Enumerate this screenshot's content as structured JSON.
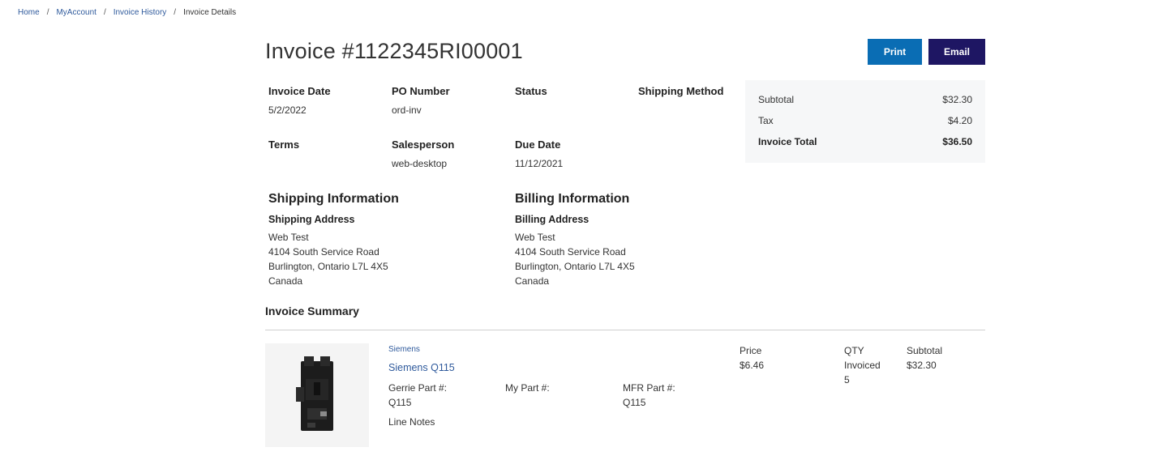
{
  "breadcrumb": {
    "items": [
      "Home",
      "MyAccount",
      "Invoice History"
    ],
    "current": "Invoice Details",
    "separator": "/"
  },
  "invoice": {
    "title": "Invoice #1122345RI00001"
  },
  "actions": {
    "print_label": "Print",
    "email_label": "Email"
  },
  "details": {
    "invoice_date_label": "Invoice Date",
    "invoice_date": "5/2/2022",
    "po_number_label": "PO Number",
    "po_number": "ord-inv",
    "status_label": "Status",
    "status": "",
    "shipping_method_label": "Shipping Method",
    "shipping_method": "",
    "terms_label": "Terms",
    "terms": "",
    "salesperson_label": "Salesperson",
    "salesperson": "web-desktop",
    "due_date_label": "Due Date",
    "due_date": "11/12/2021"
  },
  "totals": {
    "subtotal_label": "Subtotal",
    "subtotal": "$32.30",
    "tax_label": "Tax",
    "tax": "$4.20",
    "total_label": "Invoice Total",
    "total": "$36.50"
  },
  "shipping": {
    "heading": "Shipping Information",
    "address_label": "Shipping Address",
    "lines": [
      "Web Test",
      "4104 South Service Road",
      "Burlington, Ontario L7L 4X5",
      "Canada"
    ]
  },
  "billing": {
    "heading": "Billing Information",
    "address_label": "Billing Address",
    "lines": [
      "Web Test",
      "4104 South Service Road",
      "Burlington, Ontario L7L 4X5",
      "Canada"
    ]
  },
  "summary": {
    "heading": "Invoice Summary",
    "items": [
      {
        "brand": "Siemens",
        "name": "Siemens Q115",
        "gerrie_part_label": "Gerrie Part #:",
        "gerrie_part": "Q115",
        "my_part_label": "My Part #:",
        "my_part": "",
        "mfr_part_label": "MFR Part #:",
        "mfr_part": "Q115",
        "line_notes_label": "Line Notes",
        "price_label": "Price",
        "price": "$6.46",
        "qty_label": "QTY",
        "qty_sublabel": "Invoiced",
        "qty": "5",
        "subtotal_label": "Subtotal",
        "subtotal": "$32.30"
      }
    ]
  },
  "colors": {
    "link": "#2f5a9c",
    "print_button": "#0a6db4",
    "email_button": "#1e1663",
    "summary_bg": "#f6f7f8"
  }
}
